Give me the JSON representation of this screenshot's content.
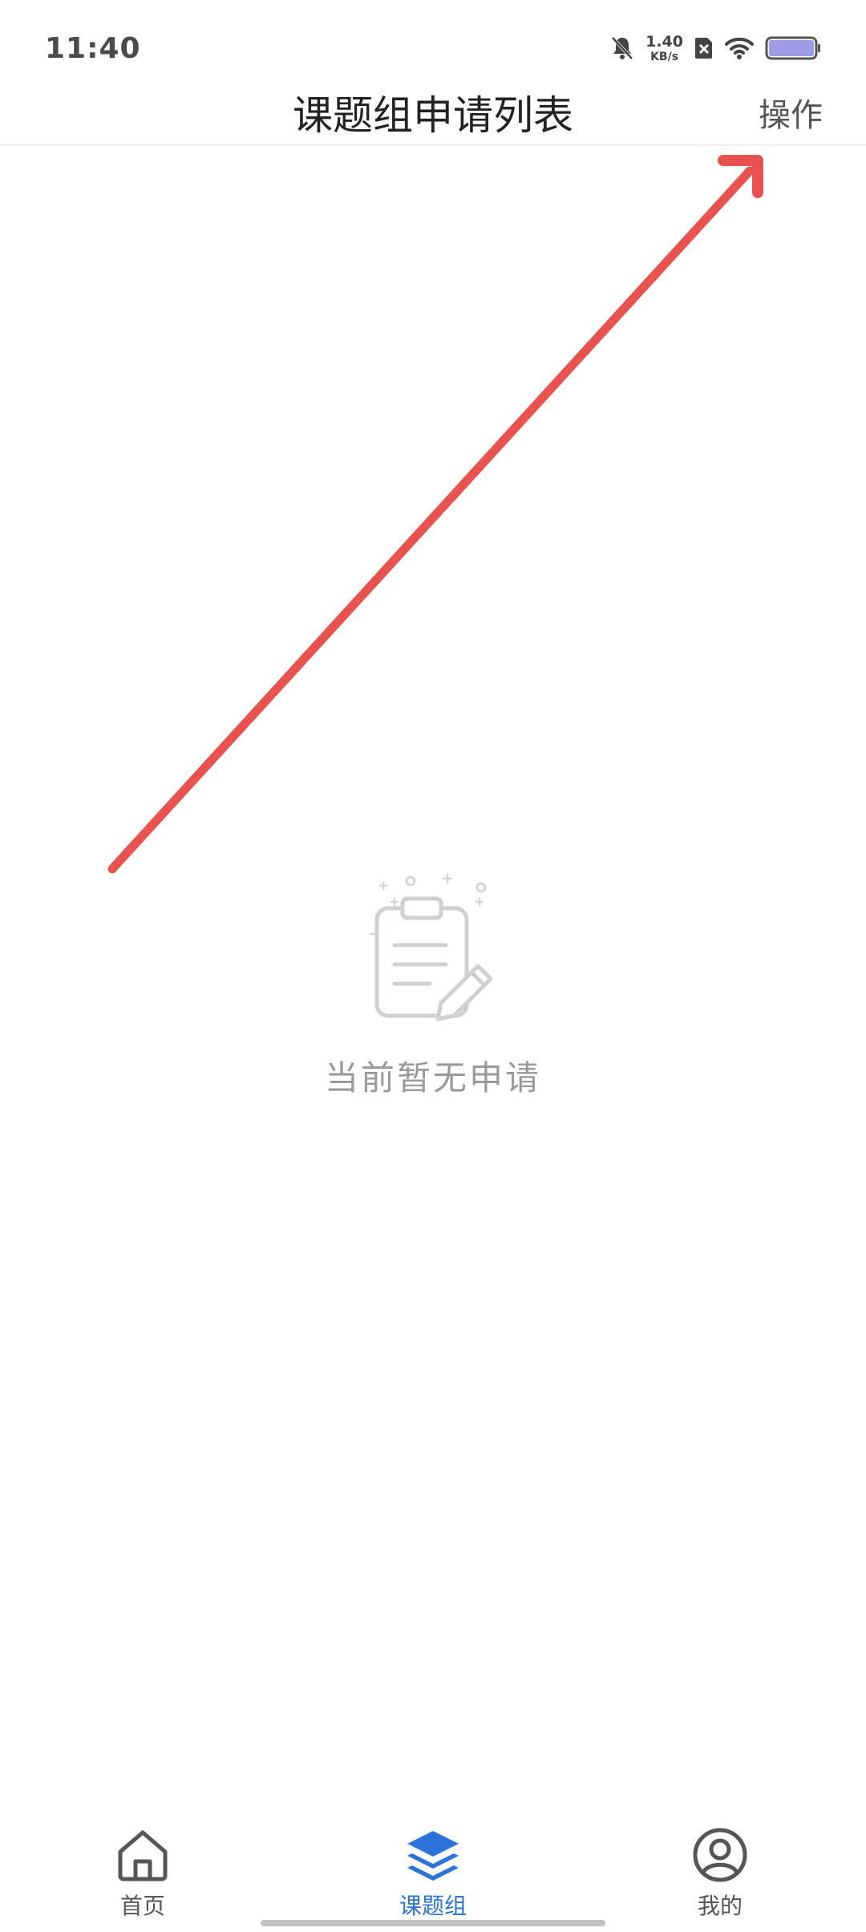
{
  "status_bar": {
    "time": "11:40",
    "net_speed_value": "1.40",
    "net_speed_unit": "KB/s",
    "icons": [
      "bell-muted-icon",
      "sim-blocked-icon",
      "wifi-icon",
      "battery-icon"
    ]
  },
  "header": {
    "title": "课题组申请列表",
    "action_label": "操作"
  },
  "empty_state": {
    "illustration": "clipboard-edit-icon",
    "message": "当前暂无申请"
  },
  "annotation": {
    "arrow_color": "#e8534f"
  },
  "tabbar": {
    "items": [
      {
        "label": "首页",
        "icon": "home-icon",
        "active": false
      },
      {
        "label": "课题组",
        "icon": "layers-icon",
        "active": true
      },
      {
        "label": "我的",
        "icon": "user-circle-icon",
        "active": false
      }
    ],
    "active_color": "#2b73d8"
  }
}
